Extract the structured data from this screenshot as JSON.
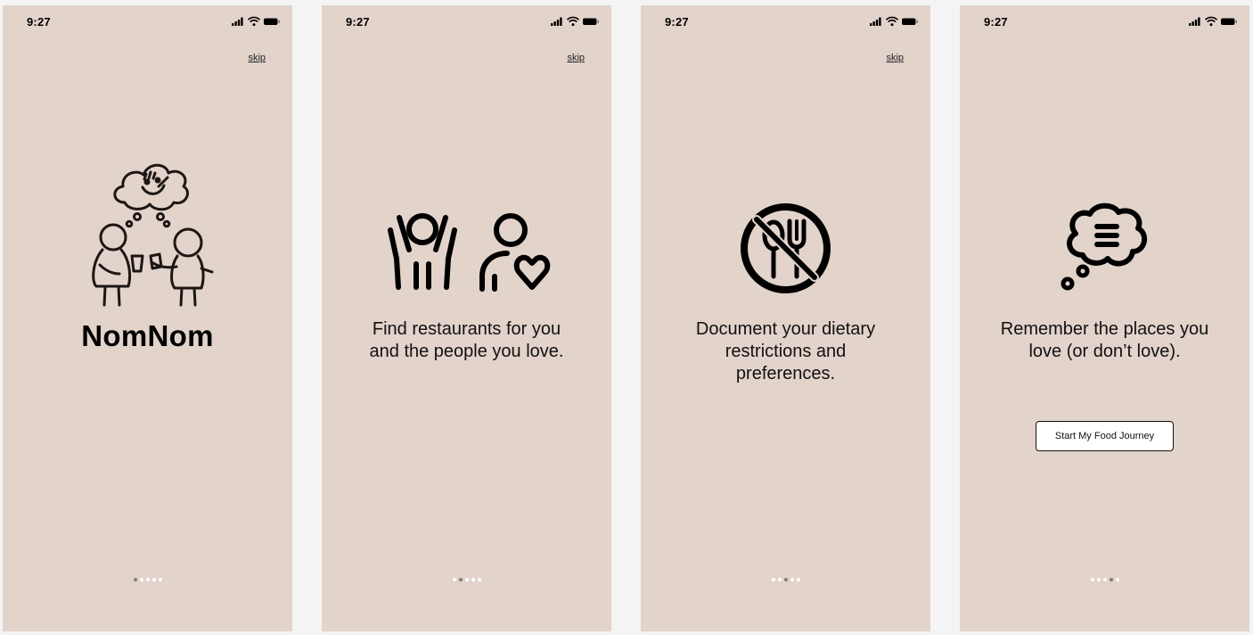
{
  "status_bar": {
    "time": "9:27"
  },
  "screens": [
    {
      "skip_label": "skip",
      "brand": "NomNom",
      "active_dot": 0
    },
    {
      "skip_label": "skip",
      "caption": [
        "Find restaurants for you",
        "and the people you love."
      ],
      "active_dot": 1
    },
    {
      "skip_label": "skip",
      "caption": [
        "Document your dietary",
        "restrictions and",
        "preferences."
      ],
      "active_dot": 2
    },
    {
      "caption": [
        "Remember the places you",
        "love (or don’t love)."
      ],
      "cta_label": "Start My Food Journey",
      "active_dot": 3
    }
  ],
  "pagination": {
    "dot_count": 5
  },
  "colors": {
    "screen_bg": "#e2d3cb",
    "page_bg": "#f4f4f4",
    "dot_inactive": "#ffffff",
    "dot_active": "#8c7a71"
  },
  "icons": [
    "signal-icon",
    "wifi-icon",
    "battery-icon",
    "friends-sharing-food-illustration",
    "cheering-person-icon",
    "person-with-heart-icon",
    "no-utensils-icon",
    "thought-bubble-icon"
  ]
}
